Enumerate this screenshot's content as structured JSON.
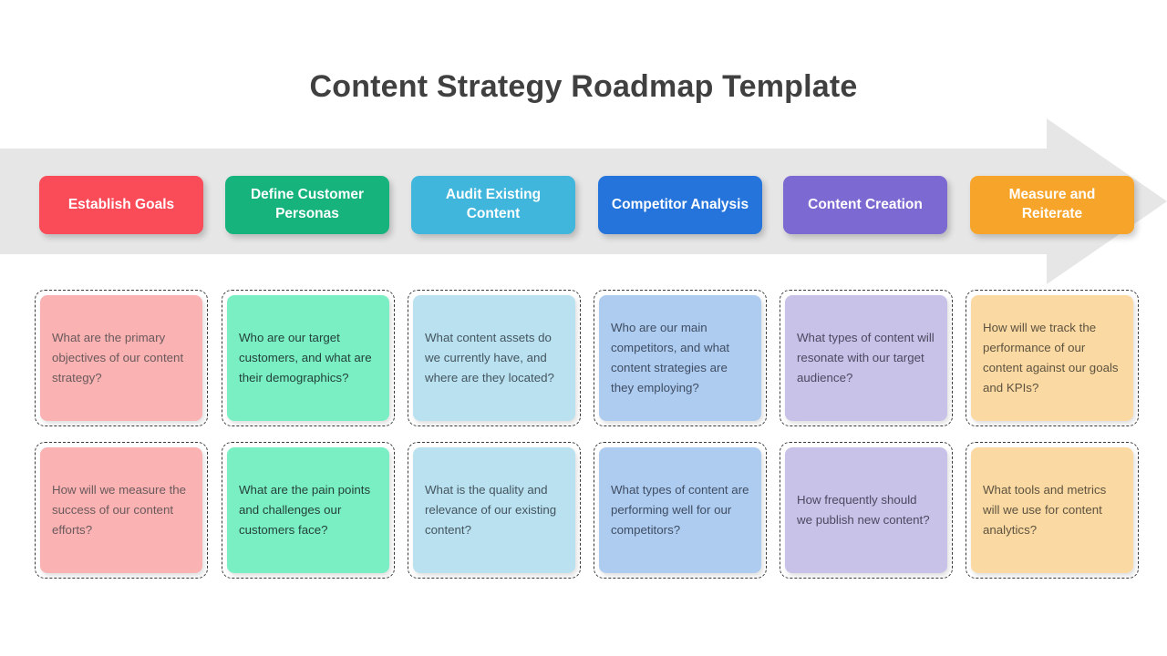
{
  "title": "Content Strategy Roadmap Template",
  "banner": {
    "background_color": "#E6E6E6",
    "shape": "right-arrow-banner"
  },
  "stages": [
    {
      "label": "Establish Goals",
      "color": "#FA4B59",
      "card_color": "#FAB2B3"
    },
    {
      "label": "Define Customer Personas",
      "color": "#16B47C",
      "card_color": "#7AEFC3"
    },
    {
      "label": "Audit Existing Content",
      "color": "#41B6DC",
      "card_color": "#B9E1F0"
    },
    {
      "label": "Competitor Analysis",
      "color": "#2574DB",
      "card_color": "#AECBF0"
    },
    {
      "label": "Content Creation",
      "color": "#7C69D1",
      "card_color": "#C8C1E8"
    },
    {
      "label": "Measure and Reiterate",
      "color": "#F7A52A",
      "card_color": "#FBD9A2"
    }
  ],
  "questions": {
    "row1": [
      "What are the primary objectives of our content strategy?",
      "Who are our target customers, and what are their demographics?",
      "What content assets do we currently have, and where are they located?",
      "Who are our main competitors, and what content strategies are they employing?",
      "What types of content will resonate with our target audience?",
      "How will we track the performance of our content against our goals and KPIs?"
    ],
    "row2": [
      "How will we measure the success of our content efforts?",
      "What are the pain points and challenges our customers face?",
      "What is the quality and relevance of our existing content?",
      "What types of content are performing well for our competitors?",
      "How frequently should we publish new content?",
      "What tools and metrics will we use for content analytics?"
    ]
  }
}
